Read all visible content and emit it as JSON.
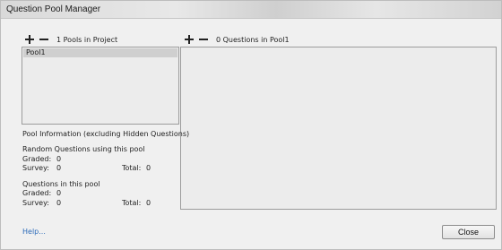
{
  "window": {
    "title": "Question Pool Manager"
  },
  "pools_panel": {
    "add_icon": "plus-icon",
    "remove_icon": "minus-icon",
    "count_label": "1 Pools in Project",
    "pools": [
      "Pool1"
    ],
    "selected_pool": "Pool1"
  },
  "questions_panel": {
    "add_icon": "plus-icon",
    "remove_icon": "minus-icon",
    "count_label": "0 Questions in Pool1"
  },
  "pool_information": {
    "heading": "Pool Information (excluding Hidden Questions)",
    "random_section": {
      "heading": "Random Questions using this pool",
      "graded_label": "Graded:",
      "graded_value": "0",
      "survey_label": "Survey:",
      "survey_value": "0",
      "total_label": "Total:",
      "total_value": "0"
    },
    "in_pool_section": {
      "heading": "Questions in this pool",
      "graded_label": "Graded:",
      "graded_value": "0",
      "survey_label": "Survey:",
      "survey_value": "0",
      "total_label": "Total:",
      "total_value": "0"
    }
  },
  "footer": {
    "help_label": "Help...",
    "close_label": "Close"
  },
  "colors": {
    "link": "#2a6ab9",
    "selection": "#cfcfcf",
    "panel_border": "#9c9c9c"
  }
}
